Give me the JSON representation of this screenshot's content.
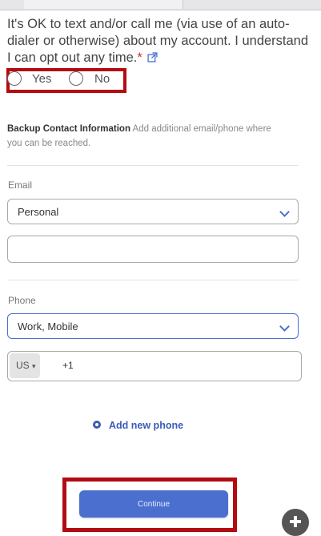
{
  "consent": {
    "text": "It's OK to text and/or call me (via use of an auto-dialer or otherwise) about my account. I understand I can opt out any time.",
    "required_mark": "*",
    "options": {
      "yes": "Yes",
      "no": "No"
    }
  },
  "backup": {
    "heading": "Backup Contact Information",
    "description": "Add additional email/phone where you can be reached."
  },
  "email": {
    "label": "Email",
    "type_value": "Personal",
    "address_value": ""
  },
  "phone": {
    "label": "Phone",
    "type_value": "Work, Mobile",
    "country_code": "US",
    "dial_code": "+1",
    "number_value": "",
    "add_label": "Add new phone"
  },
  "actions": {
    "continue_label": "Continue"
  },
  "colors": {
    "accent": "#4a6fcf",
    "highlight": "#b30b12",
    "required": "#d0342c"
  }
}
